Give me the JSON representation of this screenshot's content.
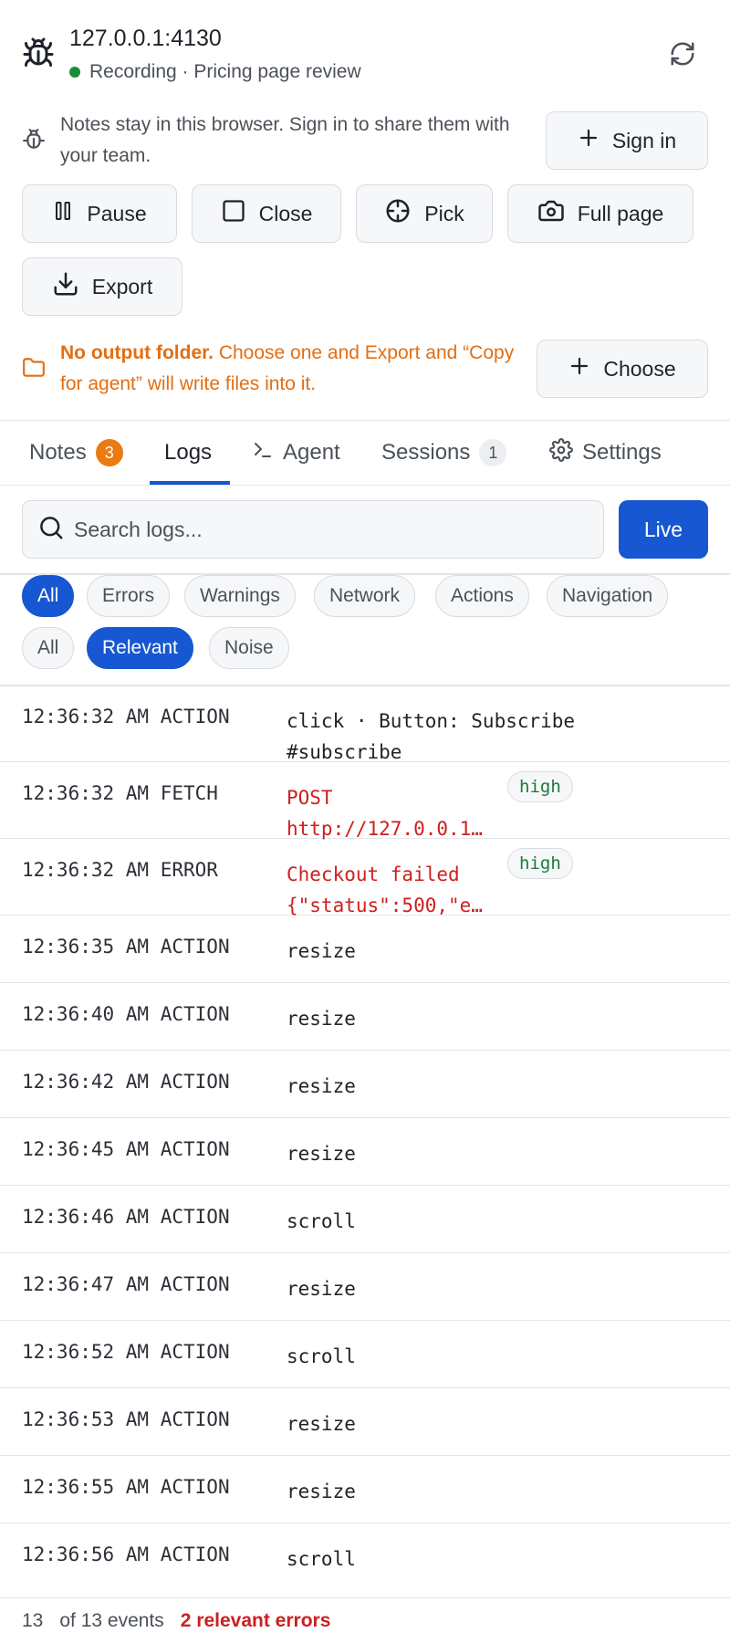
{
  "header": {
    "title": "127.0.0.1:4130",
    "status_text": "Recording · Pricing page review",
    "status_color": "#1a8a3b",
    "icon": "bug-icon",
    "refresh_icon": "refresh-icon"
  },
  "notice": {
    "text": "Notes stay in this browser. Sign in to share them with your team.",
    "sign_in_label": "Sign in"
  },
  "toolbar": {
    "pause_label": "Pause",
    "close_label": "Close",
    "pick_label": "Pick",
    "full_page_label": "Full page",
    "export_label": "Export"
  },
  "folder_notice": {
    "bold": "No output folder.",
    "text": " Choose one and Export and “Copy for agent” will write files into it.",
    "choose_label": "Choose",
    "color": "#e46e12"
  },
  "tabs": [
    {
      "label": "Notes",
      "count": "3"
    },
    {
      "label": "Logs"
    },
    {
      "label": "Agent"
    },
    {
      "label": "Sessions",
      "count": "1"
    },
    {
      "label": "Settings"
    }
  ],
  "active_tab": "Logs",
  "search": {
    "placeholder": "Search logs...",
    "live_label": "Live"
  },
  "filters": {
    "types": [
      "All",
      "Errors",
      "Warnings",
      "Network",
      "Actions",
      "Navigation"
    ],
    "active_type": "All",
    "relevance": [
      "All",
      "Relevant",
      "Noise"
    ],
    "active_relevance": "Relevant"
  },
  "logs": [
    {
      "time": "12:36:32 AM",
      "kind": "ACTION",
      "msg1": "click · Button: Subscribe",
      "msg2": "#subscribe"
    },
    {
      "time": "12:36:32 AM",
      "kind": "FETCH",
      "msg1": "POST",
      "msg2": "http://127.0.0.1…",
      "tag": "high"
    },
    {
      "time": "12:36:32 AM",
      "kind": "ERROR",
      "msg1": "Checkout failed",
      "msg2": "{\"status\":500,\"e…",
      "tag": "high"
    },
    {
      "time": "12:36:35 AM",
      "kind": "ACTION",
      "msg1": "resize"
    },
    {
      "time": "12:36:40 AM",
      "kind": "ACTION",
      "msg1": "resize"
    },
    {
      "time": "12:36:42 AM",
      "kind": "ACTION",
      "msg1": "resize"
    },
    {
      "time": "12:36:45 AM",
      "kind": "ACTION",
      "msg1": "resize"
    },
    {
      "time": "12:36:46 AM",
      "kind": "ACTION",
      "msg1": "scroll"
    },
    {
      "time": "12:36:47 AM",
      "kind": "ACTION",
      "msg1": "resize"
    },
    {
      "time": "12:36:52 AM",
      "kind": "ACTION",
      "msg1": "scroll"
    },
    {
      "time": "12:36:53 AM",
      "kind": "ACTION",
      "msg1": "resize"
    },
    {
      "time": "12:36:55 AM",
      "kind": "ACTION",
      "msg1": "resize"
    },
    {
      "time": "12:36:56 AM",
      "kind": "ACTION",
      "msg1": "scroll"
    }
  ],
  "footer": {
    "count": "13",
    "of_text": "of 13 events",
    "errors_text": "2 relevant errors"
  },
  "colors": {
    "accent": "#1757d1",
    "error": "#cc2020",
    "warning": "#e46e12",
    "high_tag": "#1a7a3a"
  }
}
